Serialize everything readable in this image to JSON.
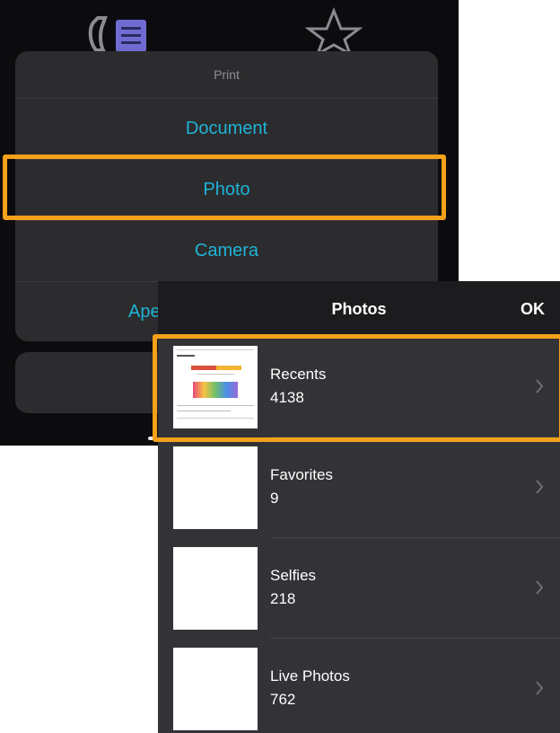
{
  "print_sheet": {
    "title": "Print",
    "items": [
      {
        "label": "Document"
      },
      {
        "label": "Photo"
      },
      {
        "label": "Camera"
      },
      {
        "label": "Ape"
      }
    ]
  },
  "photos_picker": {
    "title": "Photos",
    "ok_label": "OK",
    "albums": [
      {
        "name": "Recents",
        "count": "4138"
      },
      {
        "name": "Favorites",
        "count": "9"
      },
      {
        "name": "Selfies",
        "count": "218"
      },
      {
        "name": "Live Photos",
        "count": "762"
      }
    ]
  },
  "icons": {
    "app": "print-app-icon",
    "star": "star-icon",
    "chevron": "chevron-right-icon"
  },
  "colors": {
    "accent_link": "#1fb3d7",
    "highlight_frame": "#f5a11a",
    "sheet_bg": "#2c2c2e",
    "row_bg": "#333337"
  }
}
